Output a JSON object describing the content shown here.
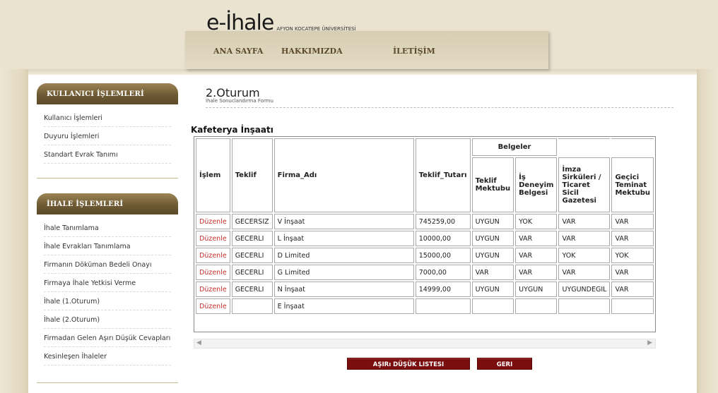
{
  "header": {
    "logo_main": "e-İhale",
    "logo_sub": "AFYON KOCATEPE ÜNİVERSİTESİ",
    "nav": [
      "ANA SAYFA",
      "HAKKIMIZDA",
      "İLETİŞİM"
    ]
  },
  "sidebar": {
    "user_section": {
      "title": "KULLANICI İŞLEMLERİ",
      "items": [
        "Kullanıcı İşlemleri",
        "Duyuru İşlemleri",
        "Standart Evrak Tanımı"
      ]
    },
    "tender_section": {
      "title": "İHALE İŞLEMLERİ",
      "items": [
        "İhale Tanımlama",
        "İhale Evrakları Tanımlama",
        "Firmanın Döküman Bedeli Onayı",
        "Firmaya İhale Yetkisi Verme",
        "İhale (1.Oturum)",
        "İhale (2.Oturum)",
        "Firmadan Gelen Aşırı Düşük Cevapları",
        "Kesinleşen İhaleler"
      ]
    }
  },
  "main": {
    "title": "2.Oturum",
    "subtitle": "İhale Sonuclandırma Formu",
    "section_title": "Kafeterya İnşaatı",
    "table": {
      "group_header": "Belgeler",
      "headers": {
        "islem": "İşlem",
        "teklif": "Teklif",
        "firma": "Firma_Adı",
        "tutar": "Teklif_Tutarı",
        "mektup": "Teklif Mektubu",
        "deneyim": "İş Deneyim Belgesi",
        "imza": "İmza Sirküleri / Ticaret Sicil Gazetesi",
        "teminat": "Geçici Teminat Mektubu"
      },
      "rows": [
        {
          "islem": "Düzenle",
          "teklif": "GECERSIZ",
          "firma": "V İnşaat",
          "tutar": "745259,00",
          "mektup": "UYGUN",
          "deneyim": "YOK",
          "imza": "VAR",
          "teminat": "VAR"
        },
        {
          "islem": "Düzenle",
          "teklif": "GECERLI",
          "firma": "L İnşaat",
          "tutar": "10000,00",
          "mektup": "UYGUN",
          "deneyim": "VAR",
          "imza": "VAR",
          "teminat": "VAR"
        },
        {
          "islem": "Düzenle",
          "teklif": "GECERLI",
          "firma": "D Limited",
          "tutar": "15000,00",
          "mektup": "UYGUN",
          "deneyim": "VAR",
          "imza": "YOK",
          "teminat": "YOK"
        },
        {
          "islem": "Düzenle",
          "teklif": "GECERLI",
          "firma": "G Limited",
          "tutar": "7000,00",
          "mektup": "VAR",
          "deneyim": "VAR",
          "imza": "VAR",
          "teminat": "VAR"
        },
        {
          "islem": "Düzenle",
          "teklif": "GECERLI",
          "firma": "N İnşaat",
          "tutar": "14999,00",
          "mektup": "UYGUN",
          "deneyim": "UYGUN",
          "imza": "UYGUNDEGIL",
          "teminat": "VAR"
        },
        {
          "islem": "Düzenle",
          "teklif": "",
          "firma": "E İnşaat",
          "tutar": "",
          "mektup": "",
          "deneyim": "",
          "imza": "",
          "teminat": ""
        }
      ]
    },
    "buttons": {
      "low_list": "AŞIRı DÜŞÜK LISTESI",
      "back": "GERI"
    }
  },
  "icons": {
    "scroll_left": "scroll-left-arrow-icon",
    "scroll_right": "scroll-right-arrow-icon"
  },
  "colors": {
    "edit_link": "#c9302c",
    "button_bg": "#7a0d0d",
    "sidebar_header": "#6e5a34",
    "frame": "#eae3cf"
  }
}
